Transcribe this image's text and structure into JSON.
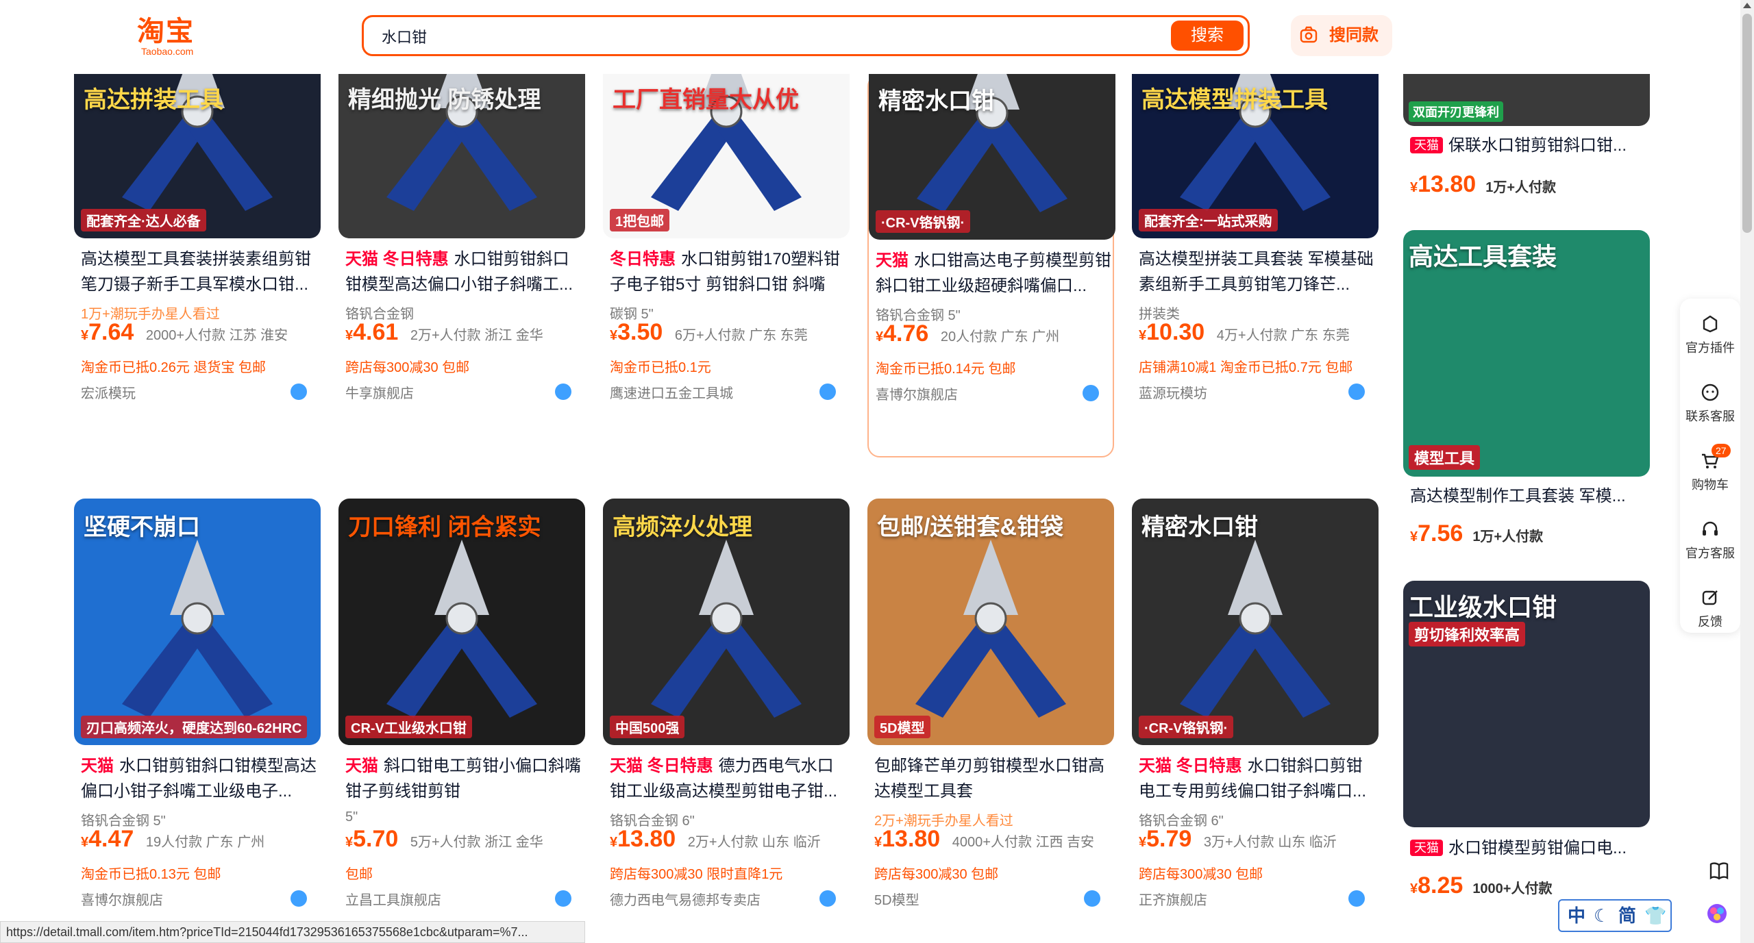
{
  "header": {
    "logo_cn": "淘宝",
    "logo_en": "Taobao.com",
    "search_value": "水口钳",
    "search_button": "搜索",
    "image_search": "搜同款"
  },
  "products_row1": [
    {
      "title_pre": "",
      "title": "高达模型工具套装拼装素组剪钳笔刀镊子新手工具军模水口钳...",
      "attr": "1万+潮玩手办星人看过",
      "attr_orange": true,
      "price": "7.64",
      "sales": "2000+人付款",
      "loc": "江苏 淮安",
      "promo": "淘金币已抵0.26元  退货宝  包邮",
      "shop": "宏派模玩",
      "thumb_text": "高达拼装工具",
      "thumb_sub": "配套齐全·达人必备"
    },
    {
      "title_pre": "天猫 冬日特惠",
      "title": "水口钳剪钳斜口钳模型高达偏口小钳子斜嘴工...",
      "attr": "铬钒合金钢",
      "attr_orange": false,
      "price": "4.61",
      "sales": "2万+人付款",
      "loc": "浙江 金华",
      "promo": "跨店每300减30  包邮",
      "shop": "牛享旗舰店",
      "thumb_text": "精细抛光 防锈处理",
      "thumb_sub": ""
    },
    {
      "title_pre": "冬日特惠",
      "title": "水口钳剪钳170塑料钳子电子钳5寸 剪钳斜口钳 斜嘴钳...",
      "attr": "碳钢  5\"",
      "attr_orange": false,
      "price": "3.50",
      "sales": "6万+人付款",
      "loc": "广东 东莞",
      "promo": "淘金币已抵0.1元",
      "shop": "鹰速进口五金工具城",
      "thumb_text": "工厂直销量大从优",
      "thumb_sub": "1把包邮"
    },
    {
      "title_pre": "天猫",
      "title": "水口钳高达电子剪模型剪钳斜口钳工业级超硬斜嘴偏口...",
      "attr": "铬钒合金钢  5\"",
      "attr_orange": false,
      "price": "4.76",
      "sales": "20人付款",
      "loc": "广东 广州",
      "promo": "淘金币已抵0.14元  包邮",
      "shop": "喜博尔旗舰店",
      "thumb_text": "精密水口钳",
      "thumb_sub": "·CR-V铬钒钢·"
    },
    {
      "title_pre": "",
      "title": "高达模型拼装工具套装 军模基础素组新手工具剪钳笔刀锋芒...",
      "attr": "拼装类",
      "attr_orange": false,
      "price": "10.30",
      "sales": "4万+人付款",
      "loc": "广东 东莞",
      "promo": "店铺满10减1  淘金币已抵0.7元  包邮",
      "shop": "蓝源玩模坊",
      "thumb_text": "高达模型拼装工具",
      "thumb_sub": "配套齐全:一站式采购"
    }
  ],
  "products_row2": [
    {
      "title_pre": "天猫",
      "title": "水口钳剪钳斜口钳模型高达偏口小钳子斜嘴工业级电子...",
      "attr": "铬钒合金钢  5\"",
      "attr_orange": false,
      "price": "4.47",
      "sales": "19人付款",
      "loc": "广东 广州",
      "promo": "淘金币已抵0.13元  包邮",
      "shop": "喜博尔旗舰店",
      "thumb_text": "坚硬不崩口",
      "thumb_sub": "刃口高频淬火，硬度达到60-62HRC"
    },
    {
      "title_pre": "天猫",
      "title": "斜口钳电工剪钳小偏口斜嘴钳子剪线钳剪钳",
      "attr": "5\"",
      "attr_orange": false,
      "price": "5.70",
      "sales": "5万+人付款",
      "loc": "浙江 金华",
      "promo": "包邮",
      "shop": "立昌工具旗舰店",
      "thumb_text": "刀口锋利 闭合紧实",
      "thumb_sub": "CR-V工业级水口钳"
    },
    {
      "title_pre": "天猫 冬日特惠",
      "title": "德力西电气水口钳工业级高达模型剪钳电子钳...",
      "attr": "铬钒合金钢  6\"",
      "attr_orange": false,
      "price": "13.80",
      "sales": "2万+人付款",
      "loc": "山东 临沂",
      "promo": "跨店每300减30  限时直降1元",
      "shop": "德力西电气易德邦专卖店",
      "thumb_text": "高频淬火处理",
      "thumb_sub": "中国500强"
    },
    {
      "title_pre": "",
      "title": "包邮锋芒单刃剪钳模型水口钳高达模型工具套",
      "attr": "2万+潮玩手办星人看过",
      "attr_orange": true,
      "price": "13.80",
      "sales": "4000+人付款",
      "loc": "江西 吉安",
      "promo": "跨店每300减30  包邮",
      "shop": "5D模型",
      "thumb_text": "包邮/送钳套&钳袋",
      "thumb_sub": "5D模型"
    },
    {
      "title_pre": "天猫 冬日特惠",
      "title": "水口钳斜口剪钳电工专用剪线偏口钳子斜嘴口...",
      "attr": "铬钒合金钢  6\"",
      "attr_orange": false,
      "price": "5.79",
      "sales": "3万+人付款",
      "loc": "山东 临沂",
      "promo": "跨店每300减30  包邮",
      "shop": "正齐旗舰店",
      "thumb_text": "精密水口钳",
      "thumb_sub": "·CR-V铬钒钢·"
    }
  ],
  "right_column": [
    {
      "tmall": "天猫",
      "title": "保联水口钳剪钳斜口钳...",
      "price": "13.80",
      "sales": "1万+人付款",
      "thumb_text": "双面开刃更锋利"
    },
    {
      "tmall": "",
      "title": "高达模型制作工具套装 军模...",
      "price": "7.56",
      "sales": "1万+人付款",
      "thumb_text": "高达工具套装",
      "thumb_sub": "模型工具"
    },
    {
      "tmall": "天猫",
      "title": "水口钳模型剪钳偏口电...",
      "price": "8.25",
      "sales": "1000+人付款",
      "thumb_text": "工业级水口钳",
      "thumb_sub": "剪切锋利效率高"
    }
  ],
  "toolbar": {
    "plugin": "官方插件",
    "contact": "联系客服",
    "cart": "购物车",
    "cart_count": "27",
    "service": "官方客服",
    "feedback": "反馈"
  },
  "status_url": "https://detail.tmall.com/item.htm?priceTId=215044fd17329536165375568e1cbc&utparam=%7...",
  "ime": {
    "lang": "中",
    "mode": "简"
  },
  "currency": "¥",
  "colors": {
    "brand": "#ff5000",
    "tmall": "#ff0036"
  }
}
